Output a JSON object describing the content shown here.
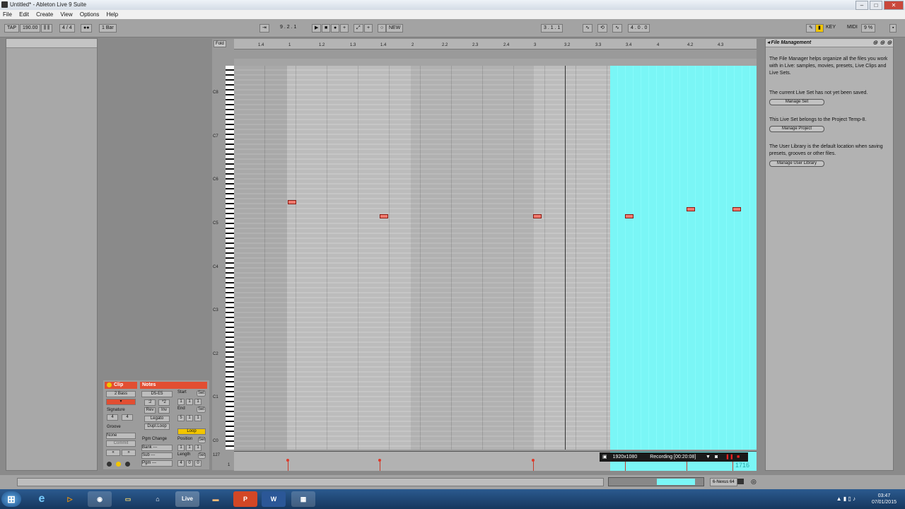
{
  "window": {
    "title": "Untitled* - Ableton Live 9 Suite",
    "min": "–",
    "max": "□",
    "close": "✕"
  },
  "menu": [
    "File",
    "Edit",
    "Create",
    "View",
    "Options",
    "Help"
  ],
  "control_bar": {
    "tap": "TAP",
    "tempo": "190.00",
    "signature": "4 / 4",
    "quantize": "1 Bar",
    "position": "9 . 2 . 1",
    "new": "NEW",
    "loop_start": "3 . 1 . 1",
    "loop_length": "4 . 0 . 0",
    "key": "KEY",
    "midi": "MIDI",
    "cpu": "9 %"
  },
  "ruler": {
    "fold": "Fold",
    "ticks": [
      "1.4",
      "1",
      "1.2",
      "1.3",
      "1.4",
      "2",
      "2.2",
      "2.3",
      "2.4",
      "3",
      "3.2",
      "3.3",
      "3.4",
      "4",
      "4.2",
      "4.3"
    ]
  },
  "octaves": [
    "C8",
    "C7",
    "C6",
    "C5",
    "C4",
    "C3",
    "C2",
    "C1",
    "C0"
  ],
  "velocity": {
    "top": "127",
    "bottom": "1"
  },
  "clip_view": {
    "clip_header": "Clip",
    "notes_header": "Notes",
    "clip_name": "2 Bass",
    "signature_label": "Signature",
    "sig_num": "4",
    "sig_den": "4",
    "groove_label": "Groove",
    "groove_value": "None",
    "commit": "Commit",
    "range": "D5-E5",
    "half": ":2",
    "double": "*2",
    "rev": "Rev",
    "inv": "Inv",
    "legato": "Legato",
    "dupl_loop": "Dupl.Loop",
    "start_label": "Start",
    "end_label": "End",
    "set": "Set",
    "loop": "Loop",
    "position_label": "Position",
    "length_label": "Length",
    "pgm_change": "Pgm Change",
    "bank": "Bank ---",
    "sub": "Sub ---",
    "pgm": "Pgm ---",
    "start_val": [
      "1",
      "1",
      "1"
    ],
    "end_val": [
      "5",
      "1",
      "1"
    ],
    "pos_val": [
      "1",
      "1",
      "1"
    ],
    "len_val": [
      "4",
      "0",
      "0"
    ]
  },
  "recorder": {
    "resolution": "1920x1080",
    "status": "Recording [00:20:08]",
    "frames": "1716"
  },
  "file_manager": {
    "title": "File Management",
    "p1": "The File Manager helps organize all the files you work with in Live: samples, movies, presets, Live Clips and Live Sets.",
    "p2": "The current Live Set has not yet been saved.",
    "b2": "Manage Set",
    "p3": "This Live Set belongs to the Project Temp-8.",
    "b3": "Manage Project",
    "p4": "The User Library is the default location when saving presets, grooves or other files.",
    "b4": "Manage User Library"
  },
  "status": {
    "track": "6-Nexus 64"
  },
  "taskbar": {
    "time": "03:47",
    "date": "07/01/2015"
  }
}
